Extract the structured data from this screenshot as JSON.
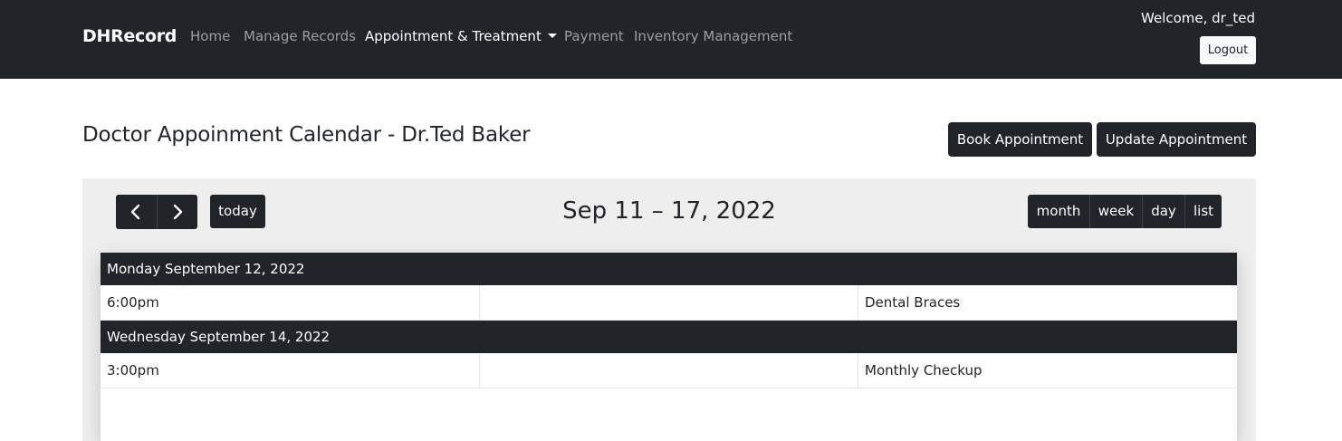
{
  "navbar": {
    "brand": "DHRecord",
    "links": [
      {
        "label": "Home"
      },
      {
        "label": "Manage Records"
      },
      {
        "label": "Appointment & Treatment"
      },
      {
        "label": "Payment"
      },
      {
        "label": "Inventory Management"
      }
    ],
    "active_link": "Appointment & Treatment",
    "welcome": "Welcome, dr_ted",
    "logout_label": "Logout"
  },
  "page": {
    "title": "Doctor Appoinment Calendar - Dr.Ted Baker",
    "book_label": "Book Appointment",
    "update_label": "Update Appointment"
  },
  "calendar": {
    "range_title": "Sep 11 – 17, 2022",
    "today_label": "today",
    "prev_icon": "chevron-left-icon",
    "next_icon": "chevron-right-icon",
    "views": [
      "month",
      "week",
      "day",
      "list"
    ],
    "days": [
      {
        "heading": "Monday September 12, 2022",
        "events": [
          {
            "time": "6:00pm",
            "title": "Dental Braces"
          }
        ]
      },
      {
        "heading": "Wednesday September 14, 2022",
        "events": [
          {
            "time": "3:00pm",
            "title": "Monthly Checkup"
          }
        ]
      }
    ]
  },
  "colors": {
    "navbar_bg": "#212529",
    "panel_bg": "#eeeeee",
    "button_bg": "#212529"
  }
}
